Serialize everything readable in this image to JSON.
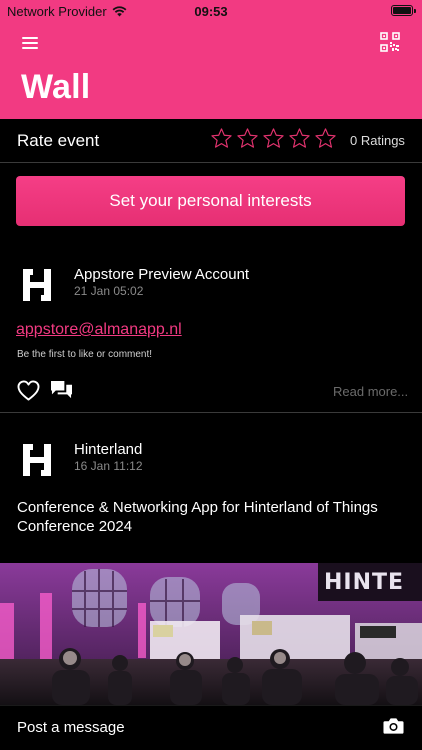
{
  "status_bar": {
    "carrier": "Network Provider",
    "time": "09:53"
  },
  "header": {
    "title": "Wall",
    "menu_icon": "hamburger-menu-icon",
    "qr_icon": "qr-code-icon",
    "accent_color": "#f23a82"
  },
  "rating": {
    "label": "Rate event",
    "stars_total": 5,
    "stars_filled": 0,
    "count_text": "0 Ratings"
  },
  "interests_button": {
    "label": "Set your personal interests"
  },
  "posts": [
    {
      "author": "Appstore Preview Account",
      "time": "21 Jan 05:02",
      "link": "appstore@almanapp.nl",
      "hint": "Be the first to like or comment!",
      "read_more": "Read more..."
    },
    {
      "author": "Hinterland",
      "time": "16 Jan 11:12",
      "text": "Conference & Networking App for Hinterland of Things Conference 2024"
    }
  ],
  "bottom_bar": {
    "post_label": "Post a message",
    "camera_icon": "camera-icon"
  }
}
